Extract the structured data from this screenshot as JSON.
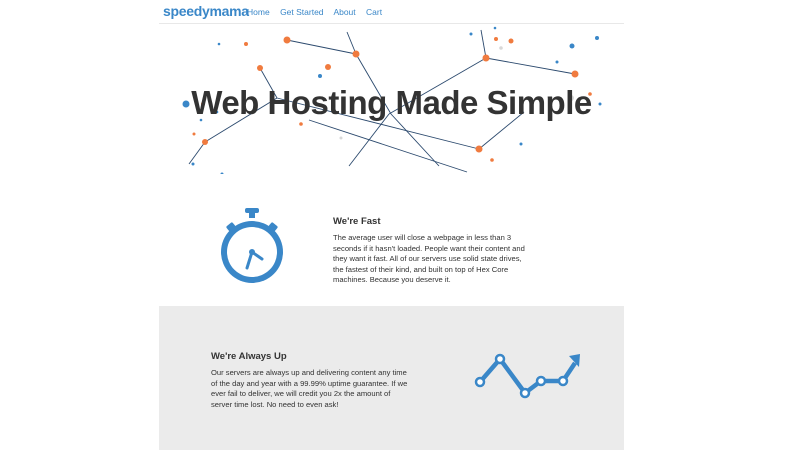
{
  "nav": {
    "logo": "speedymama",
    "links": [
      "Home",
      "Get Started",
      "About",
      "Cart"
    ]
  },
  "hero": {
    "title": "Web Hosting Made Simple"
  },
  "features": [
    {
      "heading": "We're Fast",
      "body": "The average user will close a webpage in less than 3 seconds if it hasn't loaded. People want their content and they want it fast. All of our servers use solid state drives, the fastest of their kind, and built on top of Hex Core machines. Because you deserve it.",
      "icon": "stopwatch-icon"
    },
    {
      "heading": "We're Always Up",
      "body": "Our servers are always up and delivering content any time of the day and year with a 99.99% uptime guarantee. If we ever fail to deliver, we will credit you 2x the amount of server time lost. No need to even ask!",
      "icon": "uptime-graph-icon"
    }
  ],
  "colors": {
    "accent_blue": "#3a87c8",
    "accent_orange": "#f07b3f",
    "dark_blue": "#2c4a6e",
    "section_gray": "#ebebeb"
  }
}
